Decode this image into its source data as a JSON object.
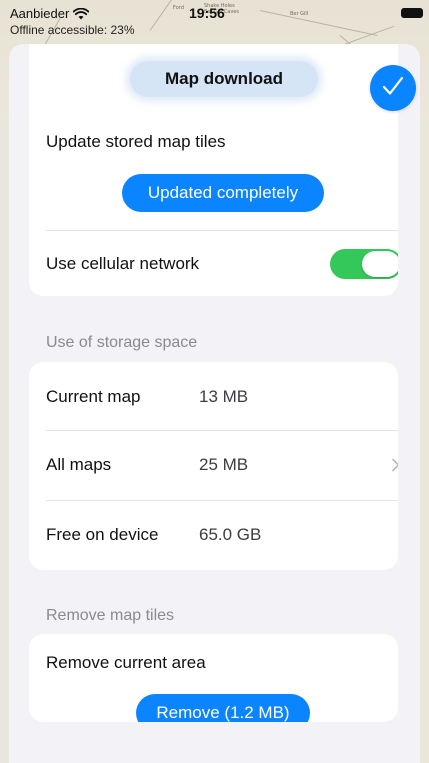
{
  "status_bar": {
    "carrier": "Aanbieder",
    "time": "19:56"
  },
  "map_overlay": {
    "offline_label": "Offline accessible: 23%",
    "place_labels": [
      "Ford",
      "Shake Holes",
      "Ber Gill Caves",
      "Ber Gill"
    ]
  },
  "sheet": {
    "title": "Map download",
    "done_icon": "checkmark-icon",
    "update_section": {
      "label": "Update stored map tiles",
      "button": "Updated completely"
    },
    "cellular": {
      "label": "Use cellular network",
      "enabled": true
    },
    "storage_section": {
      "header": "Use of storage space",
      "rows": [
        {
          "label": "Current map",
          "value": "13 MB",
          "has_chevron": false
        },
        {
          "label": "All maps",
          "value": "25 MB",
          "has_chevron": true
        },
        {
          "label": "Free on device",
          "value": "65.0 GB",
          "has_chevron": false
        }
      ]
    },
    "remove_section": {
      "header": "Remove map tiles",
      "label": "Remove current area",
      "button": "Remove (1.2 MB)"
    }
  },
  "colors": {
    "accent": "#0a84ff",
    "toggle_on": "#34c759",
    "sheet_bg": "#f2f2f7"
  }
}
